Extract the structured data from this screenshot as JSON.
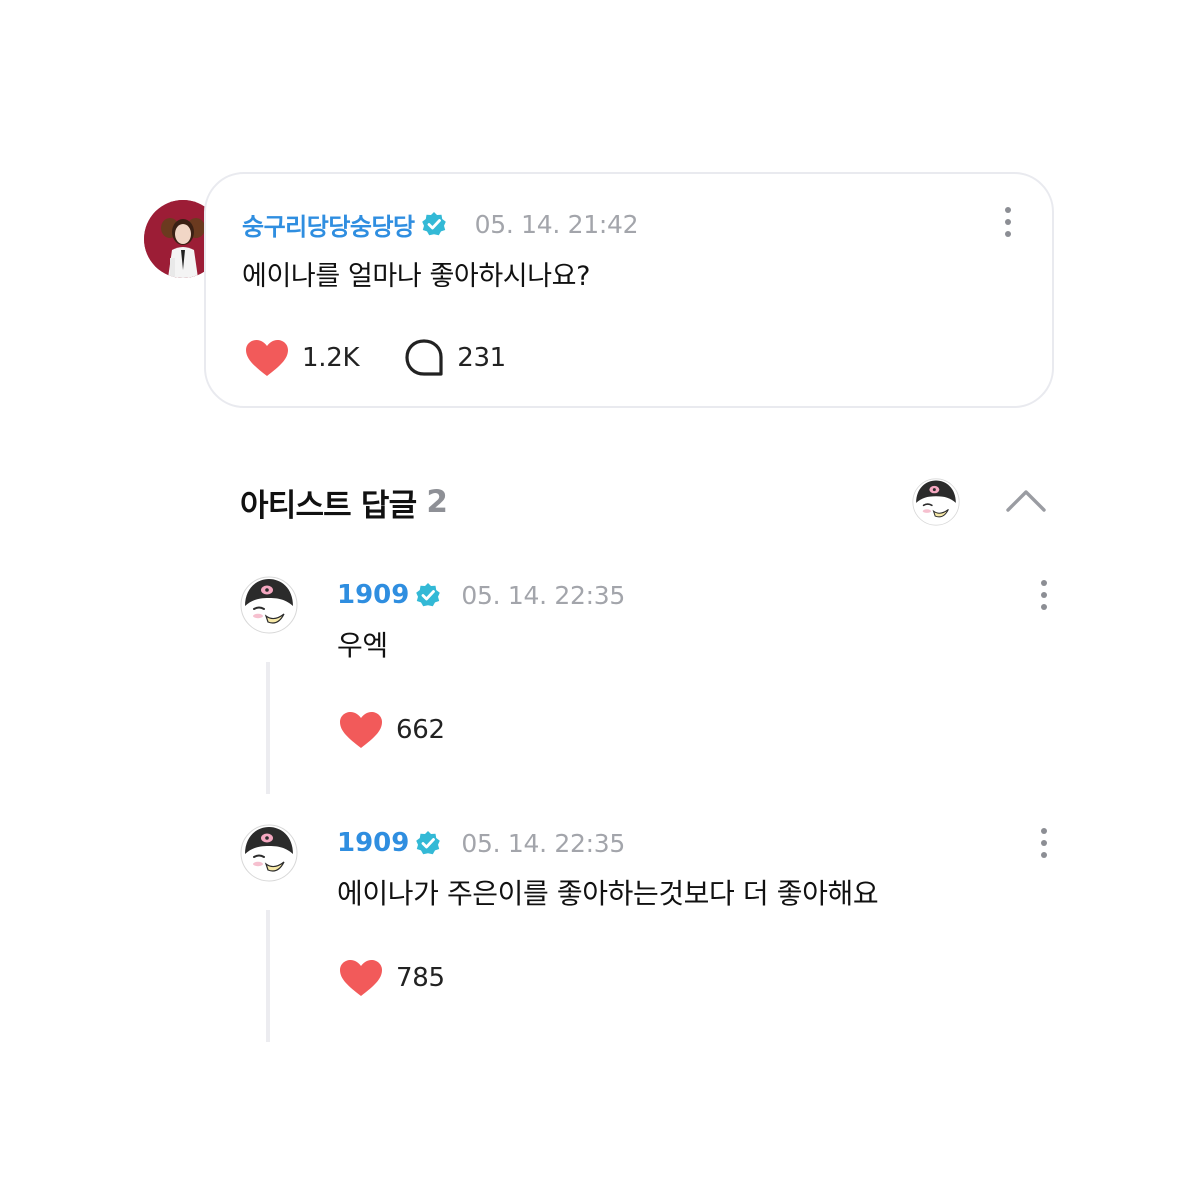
{
  "post": {
    "author": "숭구리당당숭당당",
    "timestamp": "05. 14. 21:42",
    "text": "에이나를 얼마나 좋아하시나요?",
    "likes": "1.2K",
    "comments": "231"
  },
  "artist_replies": {
    "label": "아티스트 답글",
    "count": "2",
    "replies": [
      {
        "author": "1909",
        "timestamp": "05. 14. 22:35",
        "text": "우엑",
        "likes": "662"
      },
      {
        "author": "1909",
        "timestamp": "05. 14. 22:35",
        "text": "에이나가 주은이를 좋아하는것보다 더 좋아해요",
        "likes": "785"
      }
    ]
  },
  "icons": {
    "verified": "verified-badge-icon",
    "like": "heart-icon",
    "comment": "comment-bubble-icon",
    "more": "more-vertical-icon",
    "collapse": "chevron-up-icon"
  },
  "colors": {
    "author_name": "#2f8ee0",
    "verified_badge": "#33b9d6",
    "heart": "#f25a5a",
    "timestamp": "#a3a5ab",
    "card_border": "#e9eaef"
  }
}
